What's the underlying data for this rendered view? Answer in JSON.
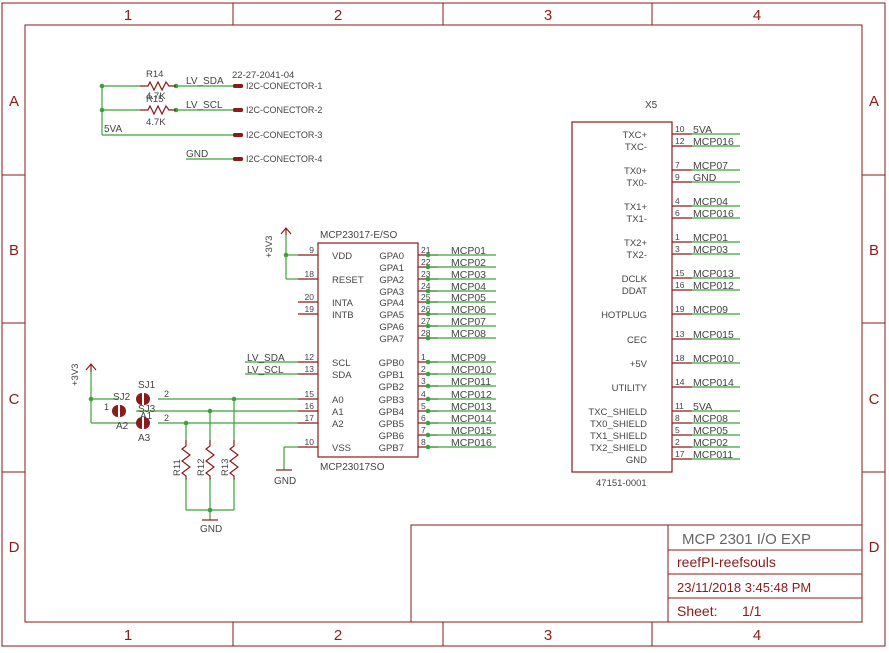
{
  "frame": {
    "col_labels": [
      "1",
      "2",
      "3",
      "4"
    ],
    "row_labels": [
      "A",
      "B",
      "C",
      "D"
    ]
  },
  "title_block": {
    "title": "MCP 2301 I/O EXP",
    "project": "reefPI-reefsouls",
    "date": "23/11/2018 3:45:48 PM",
    "sheet_label": "Sheet:",
    "sheet_value": "1/1"
  },
  "i2c_section": {
    "part_number": "22-27-2041-04",
    "r14_name": "R14",
    "r14_value": "4.7K",
    "r15_name": "R15",
    "r15_value": "4.7K",
    "net_sda": "LV_SDA",
    "net_scl": "LV_SCL",
    "net_5va": "5VA",
    "net_gnd": "GND",
    "connectors": [
      "I2C-CONECTOR-1",
      "I2C-CONECTOR-2",
      "I2C-CONECTOR-3",
      "I2C-CONECTOR-4"
    ]
  },
  "ic": {
    "name": "MCP23017-E/SO",
    "value": "MCP23017SO",
    "power_label": "+3V3",
    "gnd_label": "GND",
    "left_pins": [
      {
        "name": "VDD",
        "num": "9"
      },
      {
        "name": "RESET",
        "num": "18"
      },
      {
        "name": "INTA",
        "num": "20"
      },
      {
        "name": "INTB",
        "num": "19"
      },
      {
        "name": "SCL",
        "num": "12"
      },
      {
        "name": "SDA",
        "num": "13"
      },
      {
        "name": "A0",
        "num": "15"
      },
      {
        "name": "A1",
        "num": "16"
      },
      {
        "name": "A2",
        "num": "17"
      },
      {
        "name": "VSS",
        "num": "10"
      }
    ],
    "left_nets": [
      "LV_SDA",
      "LV_SCL"
    ],
    "right_pins": [
      {
        "name": "GPA0",
        "num": "21",
        "net": "MCP01"
      },
      {
        "name": "GPA1",
        "num": "22",
        "net": "MCP02"
      },
      {
        "name": "GPA2",
        "num": "23",
        "net": "MCP03"
      },
      {
        "name": "GPA3",
        "num": "24",
        "net": "MCP04"
      },
      {
        "name": "GPA4",
        "num": "25",
        "net": "MCP05"
      },
      {
        "name": "GPA5",
        "num": "26",
        "net": "MCP06"
      },
      {
        "name": "GPA6",
        "num": "27",
        "net": "MCP07"
      },
      {
        "name": "GPA7",
        "num": "28",
        "net": "MCP08"
      },
      {
        "name": "GPB0",
        "num": "1",
        "net": "MCP09"
      },
      {
        "name": "GPB1",
        "num": "2",
        "net": "MCP010"
      },
      {
        "name": "GPB2",
        "num": "3",
        "net": "MCP011"
      },
      {
        "name": "GPB3",
        "num": "4",
        "net": "MCP012"
      },
      {
        "name": "GPB4",
        "num": "5",
        "net": "MCP013"
      },
      {
        "name": "GPB5",
        "num": "6",
        "net": "MCP014"
      },
      {
        "name": "GPB6",
        "num": "7",
        "net": "MCP015"
      },
      {
        "name": "GPB7",
        "num": "8",
        "net": "MCP016"
      }
    ]
  },
  "address_section": {
    "power_label": "+3V3",
    "gnd_label": "GND",
    "jumpers": [
      "SJ1",
      "SJ2",
      "SJ3"
    ],
    "jumper_pin_nums": [
      "1",
      "2",
      "2",
      "2"
    ],
    "address_labels": [
      "A1",
      "A2",
      "A3"
    ],
    "resistors": [
      "R11",
      "R12",
      "R13"
    ]
  },
  "connector": {
    "name": "X5",
    "part_number": "47151-0001",
    "pins": [
      {
        "name": "TXC+",
        "num": "10",
        "net": "5VA"
      },
      {
        "name": "TXC-",
        "num": "12",
        "net": "MCP016"
      },
      {
        "name": "TX0+",
        "num": "7",
        "net": "MCP07"
      },
      {
        "name": "TX0-",
        "num": "9",
        "net": "GND"
      },
      {
        "name": "TX1+",
        "num": "4",
        "net": "MCP04"
      },
      {
        "name": "TX1-",
        "num": "6",
        "net": "MCP016"
      },
      {
        "name": "TX2+",
        "num": "1",
        "net": "MCP01"
      },
      {
        "name": "TX2-",
        "num": "3",
        "net": "MCP03"
      },
      {
        "name": "DCLK",
        "num": "15",
        "net": "MCP013"
      },
      {
        "name": "DDAT",
        "num": "16",
        "net": "MCP012"
      },
      {
        "name": "HOTPLUG",
        "num": "19",
        "net": "MCP09"
      },
      {
        "name": "CEC",
        "num": "13",
        "net": "MCP015"
      },
      {
        "name": "+5V",
        "num": "18",
        "net": "MCP010"
      },
      {
        "name": "UTILITY",
        "num": "14",
        "net": "MCP014"
      },
      {
        "name": "TXC_SHIELD",
        "num": "11",
        "net": "5VA"
      },
      {
        "name": "TX0_SHIELD",
        "num": "8",
        "net": "MCP08"
      },
      {
        "name": "TX1_SHIELD",
        "num": "5",
        "net": "MCP05"
      },
      {
        "name": "TX2_SHIELD",
        "num": "2",
        "net": "MCP02"
      },
      {
        "name": "GND",
        "num": "17",
        "net": "MCP011"
      }
    ]
  },
  "colors": {
    "frame": "#8b1a1a",
    "symbol": "#8b1a1a",
    "wire": "#3aa23a",
    "text_dark": "#444444",
    "net_text": "#444444"
  }
}
